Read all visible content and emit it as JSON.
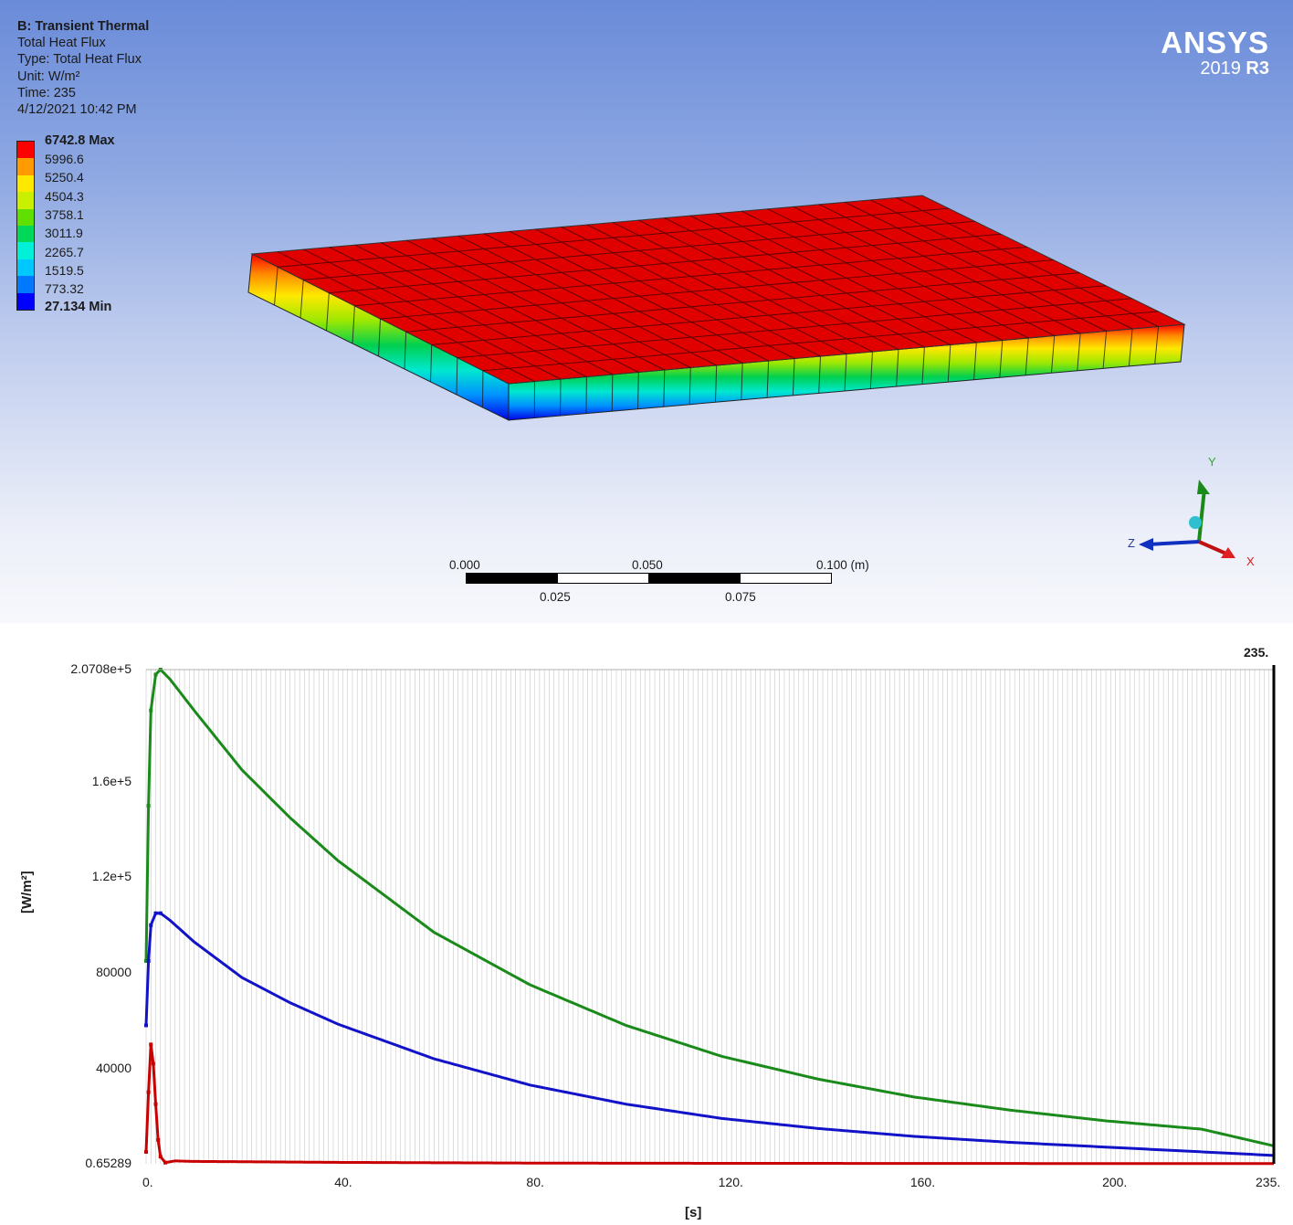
{
  "result_info": {
    "system": "B: Transient Thermal",
    "name": "Total Heat Flux",
    "type": "Type: Total Heat Flux",
    "unit": "Unit: W/m²",
    "time": "Time: 235",
    "date": "4/12/2021 10:42 PM"
  },
  "legend": {
    "max_label": "6742.8 Max",
    "levels": [
      "5996.6",
      "5250.4",
      "4504.3",
      "3758.1",
      "3011.9",
      "2265.7",
      "1519.5",
      "773.32"
    ],
    "min_label": "27.134 Min",
    "colors": [
      "#ff0000",
      "#ff9b00",
      "#ffe800",
      "#c8f000",
      "#5fe000",
      "#00d85a",
      "#00f0d8",
      "#00c8ff",
      "#0078ff",
      "#0000ff"
    ]
  },
  "logo": {
    "brand": "ANSYS",
    "version": "2019",
    "release": "R3"
  },
  "scale_bar": {
    "top_labels": [
      "0.000",
      "0.050",
      "0.100 (m)"
    ],
    "bottom_labels": [
      "0.025",
      "0.075"
    ]
  },
  "triad": {
    "x": "X",
    "y": "Y",
    "z": "Z"
  },
  "colors": {
    "max_red": "#e00000",
    "green_series": "#1a8a1a",
    "blue_series": "#1212c8",
    "red_series": "#c80000"
  },
  "chart_data": {
    "type": "line",
    "xlabel": "[s]",
    "ylabel": "[W/m²]",
    "xlim": [
      0,
      235
    ],
    "ylim": [
      0.65289,
      207080
    ],
    "x_tick_labels": [
      "0.",
      "40.",
      "80.",
      "120.",
      "160.",
      "200.",
      "235."
    ],
    "x_tick_values": [
      0,
      40,
      80,
      120,
      160,
      200,
      235
    ],
    "y_tick_labels": [
      "0.65289",
      "40000",
      "80000",
      "1.2e+5",
      "1.6e+5",
      "2.0708e+5"
    ],
    "y_tick_values": [
      0.65289,
      40000,
      80000,
      120000,
      160000,
      207080
    ],
    "marker_label": "235.",
    "grid": "vertical",
    "series": [
      {
        "color": "#1a8a1a",
        "x": [
          0,
          0.5,
          1,
          2,
          3,
          5,
          10,
          20,
          30,
          40,
          60,
          80,
          100,
          120,
          140,
          160,
          180,
          200,
          220,
          235
        ],
        "y": [
          85000,
          150000,
          190000,
          205000,
          207080,
          203000,
          190000,
          165000,
          145000,
          127000,
          97000,
          75000,
          58000,
          45000,
          35500,
          28000,
          22500,
          18000,
          14500,
          7500
        ]
      },
      {
        "color": "#1212c8",
        "x": [
          0,
          0.5,
          1,
          2,
          3,
          5,
          10,
          20,
          30,
          40,
          60,
          80,
          100,
          120,
          140,
          160,
          180,
          200,
          220,
          235
        ],
        "y": [
          58000,
          85000,
          100000,
          105000,
          105000,
          102000,
          93000,
          78000,
          67500,
          58500,
          44000,
          33000,
          25000,
          19000,
          14800,
          11500,
          9000,
          7000,
          5000,
          3500
        ]
      },
      {
        "color": "#c80000",
        "x": [
          0,
          0.5,
          1,
          1.5,
          2,
          2.5,
          3,
          4,
          6,
          10,
          40,
          80,
          120,
          160,
          200,
          235
        ],
        "y": [
          5000,
          30000,
          50000,
          42000,
          25000,
          10000,
          3000,
          500,
          1200,
          1000,
          600,
          300,
          200,
          150,
          100,
          80
        ]
      }
    ]
  }
}
